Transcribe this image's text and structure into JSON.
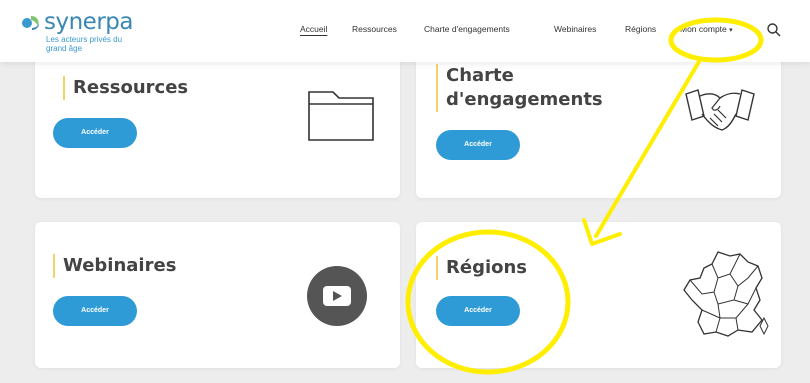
{
  "logo": {
    "brand": "synerpa",
    "tagline": "Les acteurs privés du grand âge"
  },
  "nav": {
    "items": [
      "Accueil",
      "Ressources",
      "Charte d'engagements",
      "Webinaires",
      "Régions"
    ],
    "account": "Mon compte",
    "caret": "▾"
  },
  "cards": [
    {
      "title": "Ressources",
      "button": "Accéder",
      "icon": "folder-icon"
    },
    {
      "title": "Charte d'engagements",
      "title_lines": [
        "Charte",
        "d'engagements"
      ],
      "button": "Accéder",
      "icon": "handshake-icon"
    },
    {
      "title": "Webinaires",
      "button": "Accéder",
      "icon": "play-video-icon"
    },
    {
      "title": "Régions",
      "button": "Accéder",
      "icon": "france-map-icon"
    }
  ],
  "colors": {
    "brand": "#3a87b5",
    "button": "#2f9bd6",
    "accent_bar": "#f2d26a",
    "annotation": "#ffee00"
  }
}
